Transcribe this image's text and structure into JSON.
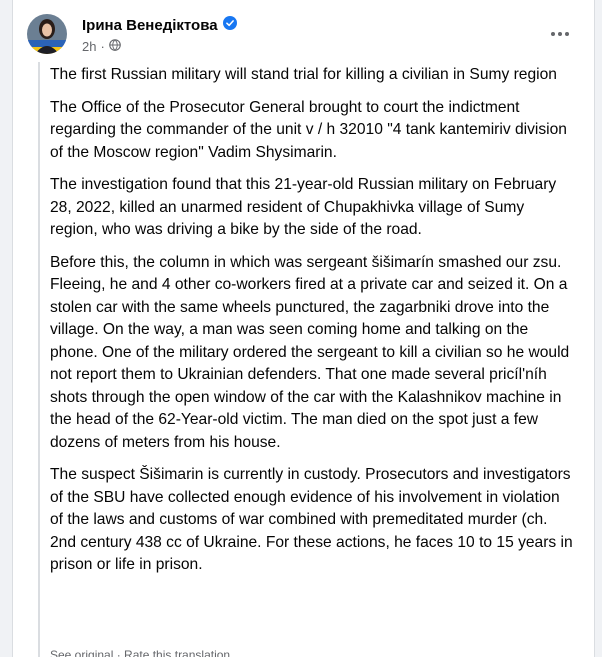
{
  "post": {
    "author": "Ірина Венедіктова",
    "time": "2h",
    "separator": "·",
    "paragraphs": [
      "The first Russian military will stand trial for killing a civilian in Sumy region",
      "The Office of the Prosecutor General brought to court the indictment regarding the commander of the unit v / h 32010 \"4 tank kantemiriv division of the Moscow region\" Vadim Shysimarin.",
      "The investigation found that this 21-year-old Russian military on February 28, 2022, killed an unarmed resident of Chupakhivka village of Sumy region, who was driving a bike by the side of the road.",
      "Before this, the column in which was sergeant šišimarín smashed our zsu. Fleeing, he and 4 other co-workers fired at a private car and seized it. On a stolen car with the same wheels punctured, the zagarbniki drove into the village. On the way, a man was seen coming home and talking on the phone. One of the military ordered the sergeant to kill a civilian so he would not report them to Ukrainian defenders. That one made several pricíl'níh shots through the open window of the car with the Kalashnikov machine in the head of the 62-Year-old victim. The man died on the spot just a few dozens of meters from his house.",
      "The suspect Šišimarin is currently in custody. Prosecutors and investigators of the SBU have collected enough evidence of his involvement in violation of the laws and customs of war combined with premeditated murder (ch. 2nd century 438 cc of Ukraine. For these actions, he faces 10 to 15 years in prison or life in prison."
    ],
    "translation_note": "See original · Rate this translation"
  },
  "colors": {
    "verified_blue": "#1877f2",
    "secondary_text": "#65676b"
  },
  "icons": {
    "verified": "verified-badge-icon",
    "privacy": "globe-icon",
    "more": "more-horizontal-icon"
  }
}
